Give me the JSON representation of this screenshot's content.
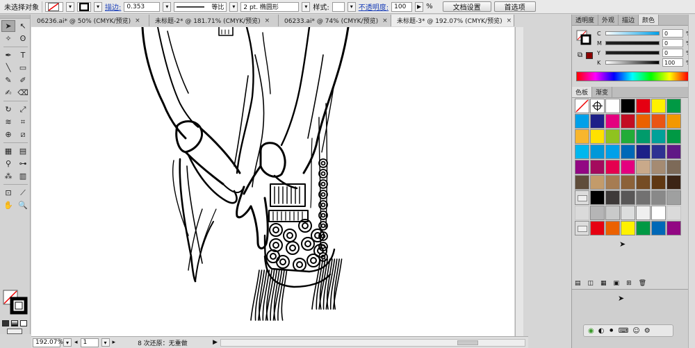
{
  "control_bar": {
    "selection_label": "未选择对象",
    "stroke_label": "描边:",
    "stroke_value": "0.353",
    "profile_label": "等比",
    "brush_label": "2 pt. 椭圆形",
    "style_label": "样式:",
    "opacity_label": "不透明度:",
    "opacity_value": "100",
    "opacity_unit": "%",
    "doc_setup_button": "文档设置",
    "preferences_button": "首选项"
  },
  "tabs": [
    {
      "label": "06236.ai* @ 50% (CMYK/预览)",
      "active": false
    },
    {
      "label": "未标题-2* @ 181.71% (CMYK/预览)",
      "active": false
    },
    {
      "label": "06233.ai* @ 74% (CMYK/预览)",
      "active": false
    },
    {
      "label": "未标题-3* @ 192.07% (CMYK/预览)",
      "active": true
    }
  ],
  "status_bar": {
    "zoom": "192.07%",
    "page": "1",
    "status_text": "8 次还原：无重做"
  },
  "panel": {
    "tabs": [
      "透明度",
      "外观",
      "描边",
      "颜色"
    ],
    "active_tab": "颜色",
    "channels": [
      {
        "label": "C",
        "value": "0"
      },
      {
        "label": "M",
        "value": "0"
      },
      {
        "label": "Y",
        "value": "0"
      },
      {
        "label": "K",
        "value": "100"
      }
    ],
    "percent_sign": "%",
    "swatch_tabs": [
      "色板",
      "渐变"
    ]
  },
  "swatches": [
    [
      "none",
      "reg",
      "#ffffff",
      "#000000",
      "#e50012",
      "#fff100",
      "#009944"
    ],
    [
      "#00a0e9",
      "#1d2088",
      "#e4007f",
      "#c30d23",
      "#eb6100",
      "#ea5514",
      "#f39800"
    ],
    [
      "#f8b62d",
      "#ffe100",
      "#8fc31f",
      "#22ac38",
      "#009b6b",
      "#00a199",
      "#009944"
    ],
    [
      "#00b7ee",
      "#0098d9",
      "#00a0e9",
      "#0068b7",
      "#1d2088",
      "#2e3192",
      "#601986"
    ],
    [
      "#920783",
      "#a40b5d",
      "#e5004f",
      "#e4007f",
      "#c9a98a",
      "#a58b72",
      "#7d6a58"
    ],
    [
      "#5f4d3b",
      "#c39b6a",
      "#a67c52",
      "#8c6239",
      "#754c24",
      "#603813",
      "#3c2415"
    ],
    [
      "folder",
      "#000000",
      "#3e3a39",
      "#595757",
      "#727171",
      "#898989",
      "#9fa0a0"
    ],
    [
      "",
      "#b5b5b6",
      "#c9caca",
      "#dcdddd",
      "#efefef",
      "#ffffff",
      ""
    ],
    [
      "folder",
      "#e60012",
      "#eb6100",
      "#fff100",
      "#009944",
      "#0068b7",
      "#920783"
    ]
  ],
  "tools": [
    [
      "select-icon",
      "➤"
    ],
    [
      "direct-select-icon",
      "↖"
    ],
    [
      "magic-wand-icon",
      "✧"
    ],
    [
      "lasso-icon",
      "ʘ"
    ],
    [
      "pen-icon",
      "✒"
    ],
    [
      "type-icon",
      "T"
    ],
    [
      "line-icon",
      "╲"
    ],
    [
      "rectangle-icon",
      "▭"
    ],
    [
      "paintbrush-icon",
      "✎"
    ],
    [
      "pencil-icon",
      "✐"
    ],
    [
      "blob-brush-icon",
      "✍"
    ],
    [
      "eraser-icon",
      "⌫"
    ],
    [
      "rotate-icon",
      "↻"
    ],
    [
      "scale-icon",
      "⤢"
    ],
    [
      "warp-icon",
      "≋"
    ],
    [
      "free-transform-icon",
      "⌗"
    ],
    [
      "shape-builder-icon",
      "⊕"
    ],
    [
      "perspective-icon",
      "⧄"
    ],
    [
      "mesh-icon",
      "▦"
    ],
    [
      "gradient-icon",
      "▤"
    ],
    [
      "eyedropper-icon",
      "⚲"
    ],
    [
      "blend-icon",
      "⊶"
    ],
    [
      "symbol-sprayer-icon",
      "⁂"
    ],
    [
      "graph-icon",
      "▥"
    ],
    [
      "artboard-icon",
      "⊡"
    ],
    [
      "slice-icon",
      "⟋"
    ],
    [
      "hand-icon",
      "✋"
    ],
    [
      "zoom-icon",
      "🔍"
    ]
  ],
  "icons": {
    "close": "×",
    "dropdown": "▾",
    "play": "▶",
    "nav_prev": "◂",
    "nav_next": "▸"
  }
}
